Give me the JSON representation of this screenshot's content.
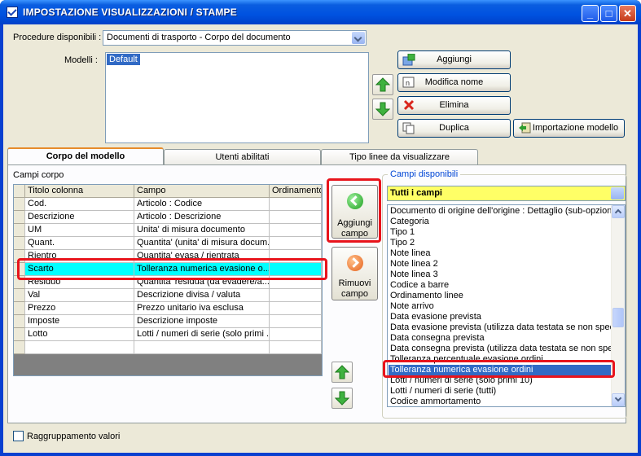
{
  "window": {
    "title": "IMPOSTAZIONE VISUALIZZAZIONI / STAMPE",
    "min_glyph": "_",
    "max_glyph": "□",
    "close_glyph": "✕"
  },
  "procedure": {
    "label": "Procedure disponibili :",
    "value": "Documenti di trasporto - Corpo del documento"
  },
  "modelli": {
    "label": "Modelli :",
    "items": [
      "Default"
    ]
  },
  "actions": {
    "aggiungi": "Aggiungi",
    "modifica": "Modifica nome",
    "elimina": "Elimina",
    "duplica": "Duplica",
    "importazione": "Importazione modello"
  },
  "tabs": [
    "Corpo del modello",
    "Utenti abilitati",
    "Tipo linee da visualizzare"
  ],
  "campi_corpo": {
    "label": "Campi corpo",
    "columns": [
      "Titolo colonna",
      "Campo",
      "Ordinamento"
    ],
    "rows": [
      [
        "Cod.",
        "Articolo : Codice",
        ""
      ],
      [
        "Descrizione",
        "Articolo : Descrizione",
        ""
      ],
      [
        "UM",
        "Unita' di misura documento",
        ""
      ],
      [
        "Quant.",
        "Quantita' (unita' di misura docum...",
        ""
      ],
      [
        "Rientro",
        "Quantita' evasa / rientrata",
        ""
      ],
      [
        "Scarto",
        "Tolleranza numerica evasione o...",
        ""
      ],
      [
        "Residuo",
        "Quantita' residua (da evadere/a...",
        ""
      ],
      [
        "Val",
        "Descrizione divisa / valuta",
        ""
      ],
      [
        "Prezzo",
        "Prezzo unitario iva esclusa",
        ""
      ],
      [
        "Imposte",
        "Descrizione imposte",
        ""
      ],
      [
        "Lotto",
        "Lotti / numeri di serie (solo primi ...",
        ""
      ],
      [
        "",
        "",
        ""
      ]
    ]
  },
  "middle_buttons": {
    "aggiungi_campo": [
      "Aggiungi",
      "campo"
    ],
    "rimuovi_campo": [
      "Rimuovi",
      "campo"
    ]
  },
  "campi_disponibili": {
    "label": "Campi disponibili",
    "filter": "Tutti i campi",
    "items": [
      "Documento di origine dell'origine : Dettaglio (sub-opzione)",
      "Categoria",
      "Tipo 1",
      "Tipo 2",
      "Note linea",
      "Note linea 2",
      "Note linea 3",
      "Codice a barre",
      "Ordinamento linee",
      "Note arrivo",
      "Data evasione prevista",
      "Data evasione prevista (utilizza data testata se non specificata)",
      "Data consegna prevista",
      "Data consegna prevista (utilizza data testata se non specificata)",
      "Tolleranza percentuale evasione ordini",
      "Tolleranza numerica evasione ordini",
      "Lotti / numeri di serie (solo primi 10)",
      "Lotti / numeri di serie (tutti)",
      "Codice ammortamento"
    ],
    "selected_index": 15
  },
  "raggruppamento": {
    "label": "Raggruppamento valori",
    "checked": false
  },
  "colors": {
    "selection": "#316ac5",
    "grid_highlight": "#00ffff",
    "annotation": "#e8141c",
    "filter_bg": "#ffff66"
  }
}
